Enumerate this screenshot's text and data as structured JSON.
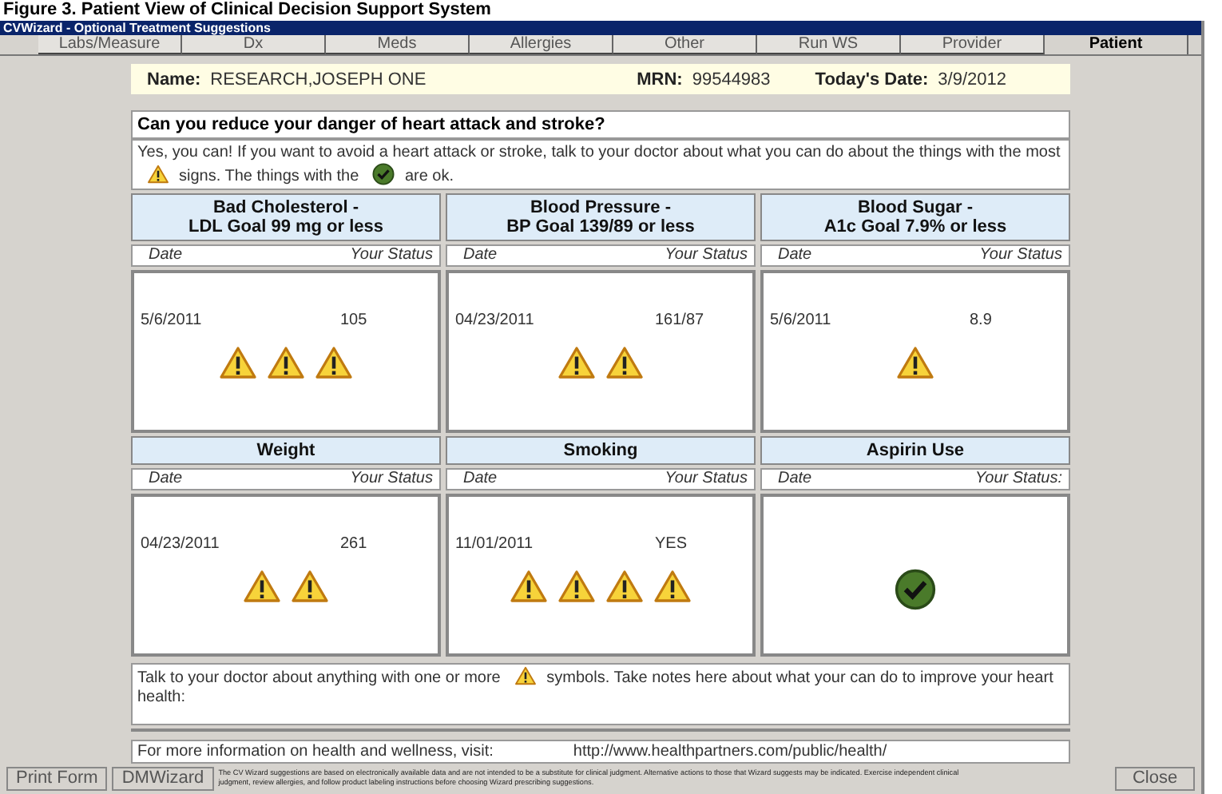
{
  "caption": "Figure 3. Patient View of Clinical Decision Support System",
  "window": {
    "title": "CVWizard - Optional Treatment Suggestions"
  },
  "tabs": [
    {
      "label": "Labs/Measure",
      "selected": false
    },
    {
      "label": "Dx",
      "selected": false
    },
    {
      "label": "Meds",
      "selected": false
    },
    {
      "label": "Allergies",
      "selected": false
    },
    {
      "label": "Other",
      "selected": false
    },
    {
      "label": "Run WS",
      "selected": false
    },
    {
      "label": "Provider",
      "selected": false
    },
    {
      "label": "Patient",
      "selected": true
    }
  ],
  "patient": {
    "name_label": "Name:",
    "name": "RESEARCH,JOSEPH ONE",
    "mrn_label": "MRN:",
    "mrn": "99544983",
    "date_label": "Today's Date:",
    "date": "3/9/2012"
  },
  "question": "Can you reduce your danger of heart attack and stroke?",
  "intro": [
    {
      "kind": "text",
      "text": "Yes, you can!  If you want to avoid a heart attack or stroke, talk to your doctor about what you can do about the things with the most"
    },
    {
      "kind": "warning"
    },
    {
      "kind": "text",
      "text": "signs.  The things with the"
    },
    {
      "kind": "ok"
    },
    {
      "kind": "text",
      "text": "are ok."
    }
  ],
  "cards": [
    {
      "title": [
        "Bad Cholesterol -",
        "LDL Goal  99 mg or less"
      ],
      "date_label": "Date",
      "status_label": "Your Status",
      "date": "5/6/2011",
      "status": "105",
      "signs": [
        {
          "kind": "warning"
        },
        {
          "kind": "warning"
        },
        {
          "kind": "warning"
        }
      ]
    },
    {
      "title": [
        "Blood Pressure -",
        "BP Goal 139/89 or less"
      ],
      "date_label": "Date",
      "status_label": "Your Status",
      "date": "04/23/2011",
      "status": "161/87",
      "signs": [
        {
          "kind": "warning"
        },
        {
          "kind": "warning"
        }
      ]
    },
    {
      "title": [
        "Blood Sugar -",
        "A1c Goal 7.9% or less"
      ],
      "date_label": "Date",
      "status_label": "Your Status",
      "date": "5/6/2011",
      "status": "8.9",
      "signs": [
        {
          "kind": "warning"
        }
      ]
    },
    {
      "title": [
        "Weight"
      ],
      "date_label": "Date",
      "status_label": "Your Status",
      "date": "04/23/2011",
      "status": "261",
      "signs": [
        {
          "kind": "warning"
        },
        {
          "kind": "warning"
        }
      ]
    },
    {
      "title": [
        "Smoking"
      ],
      "date_label": "Date",
      "status_label": "Your Status",
      "date": "11/01/2011",
      "status": "YES",
      "signs": [
        {
          "kind": "warning"
        },
        {
          "kind": "warning"
        },
        {
          "kind": "warning"
        },
        {
          "kind": "warning"
        }
      ]
    },
    {
      "title": [
        "Aspirin Use"
      ],
      "date_label": "Date",
      "status_label": "Your Status:",
      "signs": [
        {
          "kind": "ok"
        }
      ]
    }
  ],
  "notes": [
    {
      "kind": "text",
      "text": "Talk to your doctor about anything with one or more"
    },
    {
      "kind": "warning"
    },
    {
      "kind": "text",
      "text": "symbols.  Take notes here about what your can do to improve your heart health:"
    }
  ],
  "more_info": {
    "text": "For more information on health and wellness, visit:",
    "url": "http://www.healthpartners.com/public/health/"
  },
  "footer": {
    "buttons": [
      "Print Form",
      "DMWizard"
    ],
    "disclaimer": "The CV Wizard suggestions are based on electronically available data and are not intended to be a substitute for clinical judgment.  Alternative actions to those that Wizard suggests may be indicated. Exercise independent clinical judgment, review allergies, and follow product labeling instructions before choosing Wizard prescribing suggestions.",
    "close": "Close"
  }
}
